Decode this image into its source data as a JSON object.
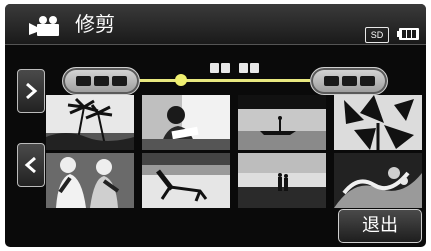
{
  "header": {
    "title": "修剪",
    "mode_icon": "movie-camera-icon",
    "media_badge": "SD",
    "battery_icon": "battery-icon"
  },
  "trim": {
    "start_handle_icon": "start-point-handle",
    "end_handle_icon": "end-point-handle",
    "position_marker_icon": "playback-position-marker",
    "accent_color": "#f0f070"
  },
  "nav": {
    "next_icon": "chevron-right-icon",
    "prev_icon": "chevron-left-icon"
  },
  "thumbnails": [
    {
      "scene": "palm-trees-beach"
    },
    {
      "scene": "person-reading"
    },
    {
      "scene": "boat-on-lake"
    },
    {
      "scene": "leaves-silhouette"
    },
    {
      "scene": "football-players"
    },
    {
      "scene": "beach-chair"
    },
    {
      "scene": "couple-on-shore"
    },
    {
      "scene": "waves-splash"
    }
  ],
  "footer": {
    "exit_label": "退出"
  }
}
